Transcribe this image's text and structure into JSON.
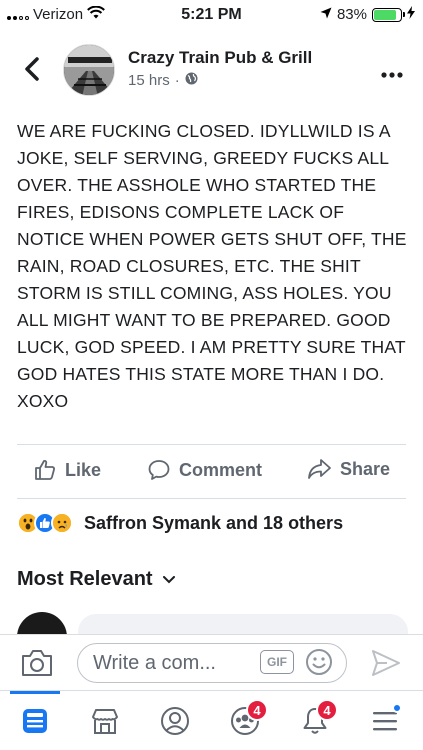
{
  "status_bar": {
    "carrier": "Verizon",
    "time": "5:21 PM",
    "battery": "83%",
    "battery_level": 0.83,
    "icons": [
      "signal-icon",
      "wifi-icon",
      "location-arrow-icon",
      "battery-icon",
      "charging-bolt-icon"
    ]
  },
  "post": {
    "page_name": "Crazy Train Pub & Grill",
    "time_ago": "15 hrs",
    "separator": "·",
    "privacy_icon": "globe-icon",
    "text": "WE ARE FUCKING CLOSED. IDYLLWILD IS A JOKE, SELF SERVING, GREEDY FUCKS ALL OVER. THE ASSHOLE WHO STARTED THE FIRES, EDISONS COMPLETE LACK OF NOTICE WHEN POWER GETS SHUT OFF, THE RAIN, ROAD CLOSURES, ETC. THE SHIT STORM IS STILL COMING, ASS HOLES. YOU ALL MIGHT WANT TO BE PREPARED. GOOD LUCK, GOD SPEED. I AM PRETTY SURE THAT GOD HATES THIS STATE MORE THAN I DO. XOXO"
  },
  "actions": {
    "like": "Like",
    "comment": "Comment",
    "share": "Share"
  },
  "reactions": {
    "icons": [
      "wow-reaction-icon",
      "like-reaction-icon",
      "sad-reaction-icon"
    ],
    "summary": "Saffron Symank and 18 others"
  },
  "comments": {
    "sort_label": "Most Relevant"
  },
  "composer": {
    "placeholder": "Write a com...",
    "gif_label": "GIF"
  },
  "nav": {
    "items": [
      {
        "name": "news-feed",
        "badge": ""
      },
      {
        "name": "marketplace",
        "badge": ""
      },
      {
        "name": "profile",
        "badge": ""
      },
      {
        "name": "groups",
        "badge": "4"
      },
      {
        "name": "notifications",
        "badge": "4"
      },
      {
        "name": "menu",
        "badge": ""
      }
    ]
  },
  "colors": {
    "accent": "#1877f2",
    "badge": "#e41e3f",
    "secondary_text": "#606770",
    "battery_fill": "#4cd964"
  }
}
